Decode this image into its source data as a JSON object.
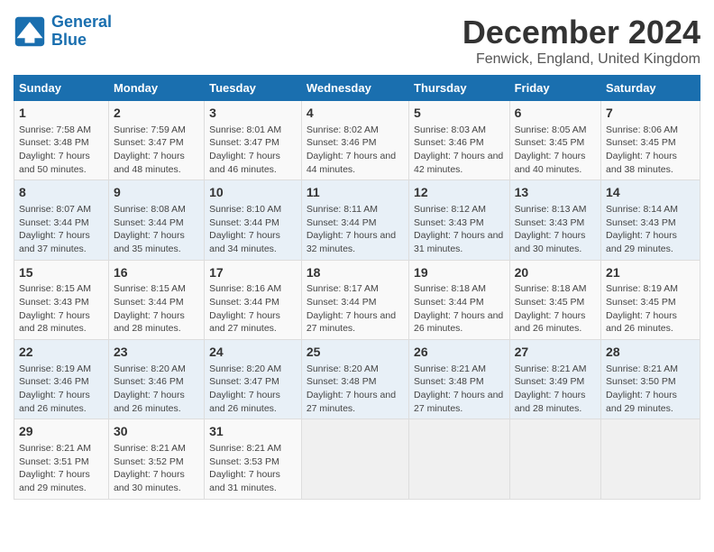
{
  "header": {
    "logo_line1": "General",
    "logo_line2": "Blue",
    "main_title": "December 2024",
    "subtitle": "Fenwick, England, United Kingdom"
  },
  "days_of_week": [
    "Sunday",
    "Monday",
    "Tuesday",
    "Wednesday",
    "Thursday",
    "Friday",
    "Saturday"
  ],
  "weeks": [
    [
      {
        "day": "1",
        "sunrise": "Sunrise: 7:58 AM",
        "sunset": "Sunset: 3:48 PM",
        "daylight": "Daylight: 7 hours and 50 minutes."
      },
      {
        "day": "2",
        "sunrise": "Sunrise: 7:59 AM",
        "sunset": "Sunset: 3:47 PM",
        "daylight": "Daylight: 7 hours and 48 minutes."
      },
      {
        "day": "3",
        "sunrise": "Sunrise: 8:01 AM",
        "sunset": "Sunset: 3:47 PM",
        "daylight": "Daylight: 7 hours and 46 minutes."
      },
      {
        "day": "4",
        "sunrise": "Sunrise: 8:02 AM",
        "sunset": "Sunset: 3:46 PM",
        "daylight": "Daylight: 7 hours and 44 minutes."
      },
      {
        "day": "5",
        "sunrise": "Sunrise: 8:03 AM",
        "sunset": "Sunset: 3:46 PM",
        "daylight": "Daylight: 7 hours and 42 minutes."
      },
      {
        "day": "6",
        "sunrise": "Sunrise: 8:05 AM",
        "sunset": "Sunset: 3:45 PM",
        "daylight": "Daylight: 7 hours and 40 minutes."
      },
      {
        "day": "7",
        "sunrise": "Sunrise: 8:06 AM",
        "sunset": "Sunset: 3:45 PM",
        "daylight": "Daylight: 7 hours and 38 minutes."
      }
    ],
    [
      {
        "day": "8",
        "sunrise": "Sunrise: 8:07 AM",
        "sunset": "Sunset: 3:44 PM",
        "daylight": "Daylight: 7 hours and 37 minutes."
      },
      {
        "day": "9",
        "sunrise": "Sunrise: 8:08 AM",
        "sunset": "Sunset: 3:44 PM",
        "daylight": "Daylight: 7 hours and 35 minutes."
      },
      {
        "day": "10",
        "sunrise": "Sunrise: 8:10 AM",
        "sunset": "Sunset: 3:44 PM",
        "daylight": "Daylight: 7 hours and 34 minutes."
      },
      {
        "day": "11",
        "sunrise": "Sunrise: 8:11 AM",
        "sunset": "Sunset: 3:44 PM",
        "daylight": "Daylight: 7 hours and 32 minutes."
      },
      {
        "day": "12",
        "sunrise": "Sunrise: 8:12 AM",
        "sunset": "Sunset: 3:43 PM",
        "daylight": "Daylight: 7 hours and 31 minutes."
      },
      {
        "day": "13",
        "sunrise": "Sunrise: 8:13 AM",
        "sunset": "Sunset: 3:43 PM",
        "daylight": "Daylight: 7 hours and 30 minutes."
      },
      {
        "day": "14",
        "sunrise": "Sunrise: 8:14 AM",
        "sunset": "Sunset: 3:43 PM",
        "daylight": "Daylight: 7 hours and 29 minutes."
      }
    ],
    [
      {
        "day": "15",
        "sunrise": "Sunrise: 8:15 AM",
        "sunset": "Sunset: 3:43 PM",
        "daylight": "Daylight: 7 hours and 28 minutes."
      },
      {
        "day": "16",
        "sunrise": "Sunrise: 8:15 AM",
        "sunset": "Sunset: 3:44 PM",
        "daylight": "Daylight: 7 hours and 28 minutes."
      },
      {
        "day": "17",
        "sunrise": "Sunrise: 8:16 AM",
        "sunset": "Sunset: 3:44 PM",
        "daylight": "Daylight: 7 hours and 27 minutes."
      },
      {
        "day": "18",
        "sunrise": "Sunrise: 8:17 AM",
        "sunset": "Sunset: 3:44 PM",
        "daylight": "Daylight: 7 hours and 27 minutes."
      },
      {
        "day": "19",
        "sunrise": "Sunrise: 8:18 AM",
        "sunset": "Sunset: 3:44 PM",
        "daylight": "Daylight: 7 hours and 26 minutes."
      },
      {
        "day": "20",
        "sunrise": "Sunrise: 8:18 AM",
        "sunset": "Sunset: 3:45 PM",
        "daylight": "Daylight: 7 hours and 26 minutes."
      },
      {
        "day": "21",
        "sunrise": "Sunrise: 8:19 AM",
        "sunset": "Sunset: 3:45 PM",
        "daylight": "Daylight: 7 hours and 26 minutes."
      }
    ],
    [
      {
        "day": "22",
        "sunrise": "Sunrise: 8:19 AM",
        "sunset": "Sunset: 3:46 PM",
        "daylight": "Daylight: 7 hours and 26 minutes."
      },
      {
        "day": "23",
        "sunrise": "Sunrise: 8:20 AM",
        "sunset": "Sunset: 3:46 PM",
        "daylight": "Daylight: 7 hours and 26 minutes."
      },
      {
        "day": "24",
        "sunrise": "Sunrise: 8:20 AM",
        "sunset": "Sunset: 3:47 PM",
        "daylight": "Daylight: 7 hours and 26 minutes."
      },
      {
        "day": "25",
        "sunrise": "Sunrise: 8:20 AM",
        "sunset": "Sunset: 3:48 PM",
        "daylight": "Daylight: 7 hours and 27 minutes."
      },
      {
        "day": "26",
        "sunrise": "Sunrise: 8:21 AM",
        "sunset": "Sunset: 3:48 PM",
        "daylight": "Daylight: 7 hours and 27 minutes."
      },
      {
        "day": "27",
        "sunrise": "Sunrise: 8:21 AM",
        "sunset": "Sunset: 3:49 PM",
        "daylight": "Daylight: 7 hours and 28 minutes."
      },
      {
        "day": "28",
        "sunrise": "Sunrise: 8:21 AM",
        "sunset": "Sunset: 3:50 PM",
        "daylight": "Daylight: 7 hours and 29 minutes."
      }
    ],
    [
      {
        "day": "29",
        "sunrise": "Sunrise: 8:21 AM",
        "sunset": "Sunset: 3:51 PM",
        "daylight": "Daylight: 7 hours and 29 minutes."
      },
      {
        "day": "30",
        "sunrise": "Sunrise: 8:21 AM",
        "sunset": "Sunset: 3:52 PM",
        "daylight": "Daylight: 7 hours and 30 minutes."
      },
      {
        "day": "31",
        "sunrise": "Sunrise: 8:21 AM",
        "sunset": "Sunset: 3:53 PM",
        "daylight": "Daylight: 7 hours and 31 minutes."
      },
      null,
      null,
      null,
      null
    ]
  ]
}
